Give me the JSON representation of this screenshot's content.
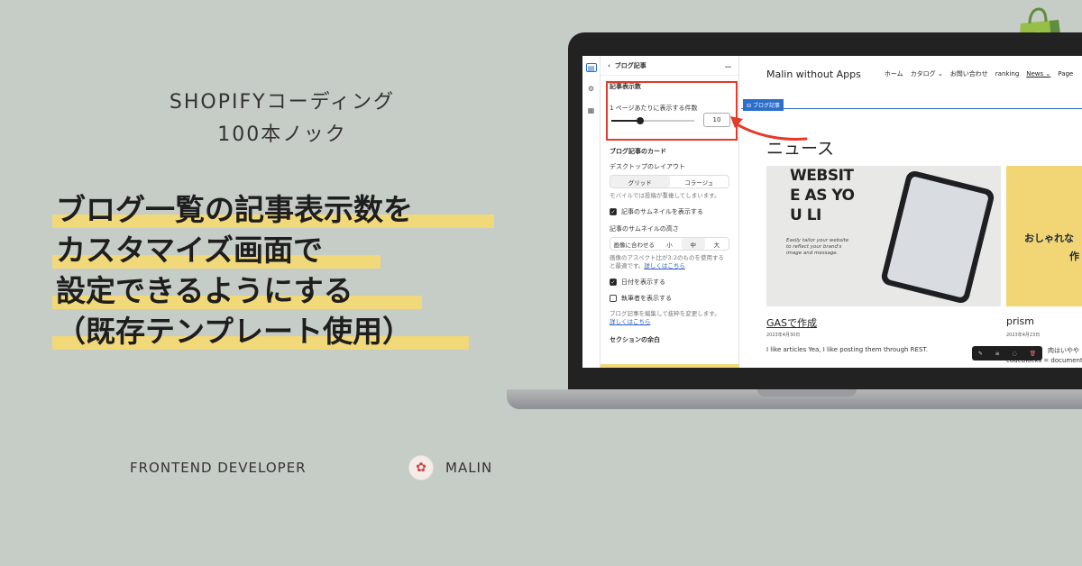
{
  "series": {
    "line1": "SHOPIFYコーディング",
    "line2": "100本ノック"
  },
  "headline": [
    "ブログ一覧の記事表示数を",
    "カスタマイズ画面で",
    "設定できるようにする",
    "（既存テンプレート使用）"
  ],
  "footer": {
    "role": "FRONTEND DEVELOPER",
    "name": "MALIN"
  },
  "editor": {
    "panel_title": "ブログ記事",
    "menu": "…",
    "section_label": "記事表示数",
    "per_page_label": "1 ページあたりに表示する件数",
    "per_page_value": "10",
    "per_page_fraction": 0.35,
    "card_heading": "ブログ記事のカード",
    "desktop_layout_label": "デスクトップのレイアウト",
    "layout_options": [
      "グリッド",
      "コラージュ"
    ],
    "mobile_note": "モバイルでは投稿が重複してしまいます。",
    "show_thumb": "記事のサムネイルを表示する",
    "thumb_height_label": "記事のサムネイルの高さ",
    "height_options": [
      "画像に合わせる",
      "小",
      "中",
      "大"
    ],
    "aspect_note": "画像のアスペクト比が3:2のものを使用すると最適です。",
    "learn_more": "詳しくはこちら",
    "show_date": "日付を表示する",
    "show_author": "執筆者を表示する",
    "edit_note": "ブログ記事を編集して抜粋を変更します。",
    "spacing_heading": "セクションの余白"
  },
  "preview": {
    "brand": "Malin without Apps",
    "nav": [
      "ホーム",
      "カタログ ⌄",
      "お問い合わせ",
      "ranking",
      "News ⌄",
      "Page"
    ],
    "section_tag": "ブログ記事",
    "news_heading": "ニュース",
    "card1_text": [
      "WEBSIT",
      "E AS YO",
      "U LI"
    ],
    "card1_small": "Easily tailor your website to reflect your brand's image and message.",
    "card2_text": "おしゃれな",
    "card2_text2": "作",
    "post1": {
      "title": "GASで作成",
      "date": "2023年4月30日",
      "excerpt": "I like articles Yea, I like posting them through REST."
    },
    "post2": {
      "title": "prism",
      "date": "2023年4月23日",
      "excerpt": "肉はいやや",
      "excerpt2": "codeblocks = document"
    }
  },
  "colors": {
    "background": "#c6ccc6",
    "highlight": "#f1d879",
    "accent_red": "#e33a2a",
    "shopify_green": "#95bf47"
  }
}
